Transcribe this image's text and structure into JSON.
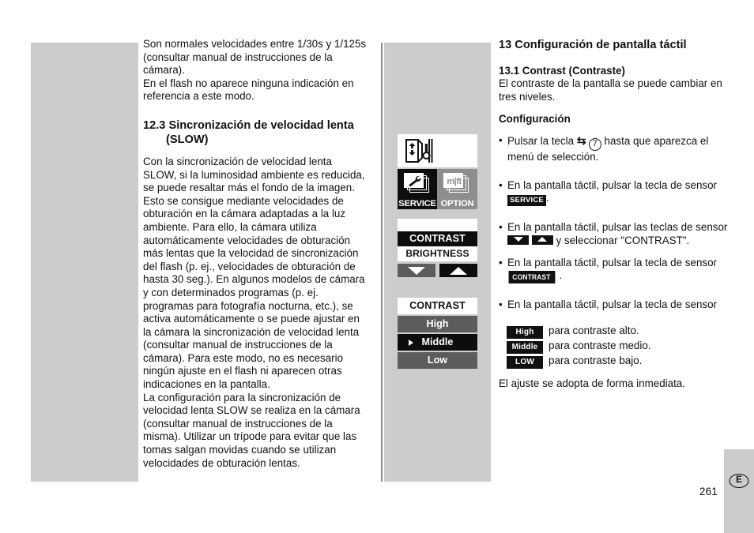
{
  "page": {
    "number": "261",
    "language_marker": "E"
  },
  "column_left": {
    "intro_paragraphs": [
      "Son normales velocidades entre 1/30s y 1/125s (consultar manual de instrucciones de la cámara).",
      "En el flash no aparece ninguna indicación en referencia a este modo."
    ],
    "heading": "12.3 Sincronización de velocidad lenta",
    "heading_second_line": "(SLOW)",
    "body_paragraphs": [
      "Con la sincronización de velocidad lenta SLOW, si la luminosidad ambiente es reducida, se puede resaltar más el fondo de la imagen. Esto se consigue mediante velocidades de obturación en la cámara adaptadas a la luz ambiente. Para ello, la cámara utiliza automáticamente velocidades de obturación más lentas que la velocidad de sincronización del flash (p. ej., velocidades de obturación de hasta 30 seg.). En algunos modelos de cámara y con determinados programas (p. ej. programas para fotografía nocturna, etc.), se activa automáticamente o se puede ajustar en la cámara la sincronización de velocidad lenta (consultar manual de instrucciones de la cámara). Para este modo, no es necesario ningún ajuste en el flash ni aparecen otras indicaciones en la pantalla.",
      "La configuración para la sincronización de velocidad lenta SLOW se realiza en la cámara (consultar manual de instrucciones de la misma). Utilizar un trípode para evitar que las tomas salgan movidas cuando se utilizan velocidades de obturación lentas."
    ]
  },
  "display_mockups": {
    "display_top": {
      "reflector_icon": "flash-reflector-icon",
      "tiles": [
        {
          "caption": "SERVICE",
          "icon": "wrench-cards-icon",
          "selected": true
        },
        {
          "caption": "OPTION",
          "icon": "mft-cards-icon",
          "label": "m|ft",
          "selected": false
        }
      ]
    },
    "display_menu": {
      "items": [
        {
          "label": "CONTRAST",
          "selected": true
        },
        {
          "label": "BRIGHTNESS",
          "selected": false
        }
      ],
      "buttons": [
        {
          "name": "arrow-down",
          "state": "grey"
        },
        {
          "name": "arrow-up",
          "state": "black"
        }
      ]
    },
    "display_levels": {
      "header": "CONTRAST",
      "options": [
        {
          "label": "High",
          "selected": false
        },
        {
          "label": "Middle",
          "selected": true
        },
        {
          "label": "Low",
          "selected": false
        }
      ]
    }
  },
  "column_right": {
    "heading": "13 Configuración de pantalla táctil",
    "subheading": "13.1 Contrast (Contraste)",
    "intro": "El contraste de la pantalla se puede cambiar en tres niveles.",
    "config_label": "Configuración",
    "steps": [
      {
        "text_before": "Pulsar la tecla",
        "symbol": "⇆",
        "key_number": "7",
        "text_after": "hasta que aparezca el menú de selección."
      },
      {
        "text_before": "En la pantalla táctil, pulsar la tecla de sensor",
        "badge": "SERVICE",
        "text_after": "."
      },
      {
        "text_before": "En la pantalla táctil, pulsar las teclas de sensor",
        "badge_arrows": [
          "down",
          "up"
        ],
        "text_middle": "y seleccionar",
        "text_after": "\"CONTRAST\"."
      },
      {
        "text_before": "En la pantalla táctil, pulsar la tecla de sensor",
        "badge": "CONTRAST",
        "text_after": "."
      },
      {
        "text_before": "En la pantalla táctil, pulsar la tecla de sensor"
      }
    ],
    "level_choices": [
      {
        "badge": "High",
        "description": "para contraste alto."
      },
      {
        "badge": "Middle",
        "description": "para contraste medio."
      },
      {
        "badge": "LOW",
        "description": "para contraste bajo."
      }
    ],
    "closing": "El ajuste se adopta de forma inmediata."
  },
  "colors": {
    "panel_gray": "#cccccc",
    "tile_black": "#0d0d0d",
    "tile_gray": "#8e8e8e",
    "row_gray": "#5c5c5c"
  }
}
